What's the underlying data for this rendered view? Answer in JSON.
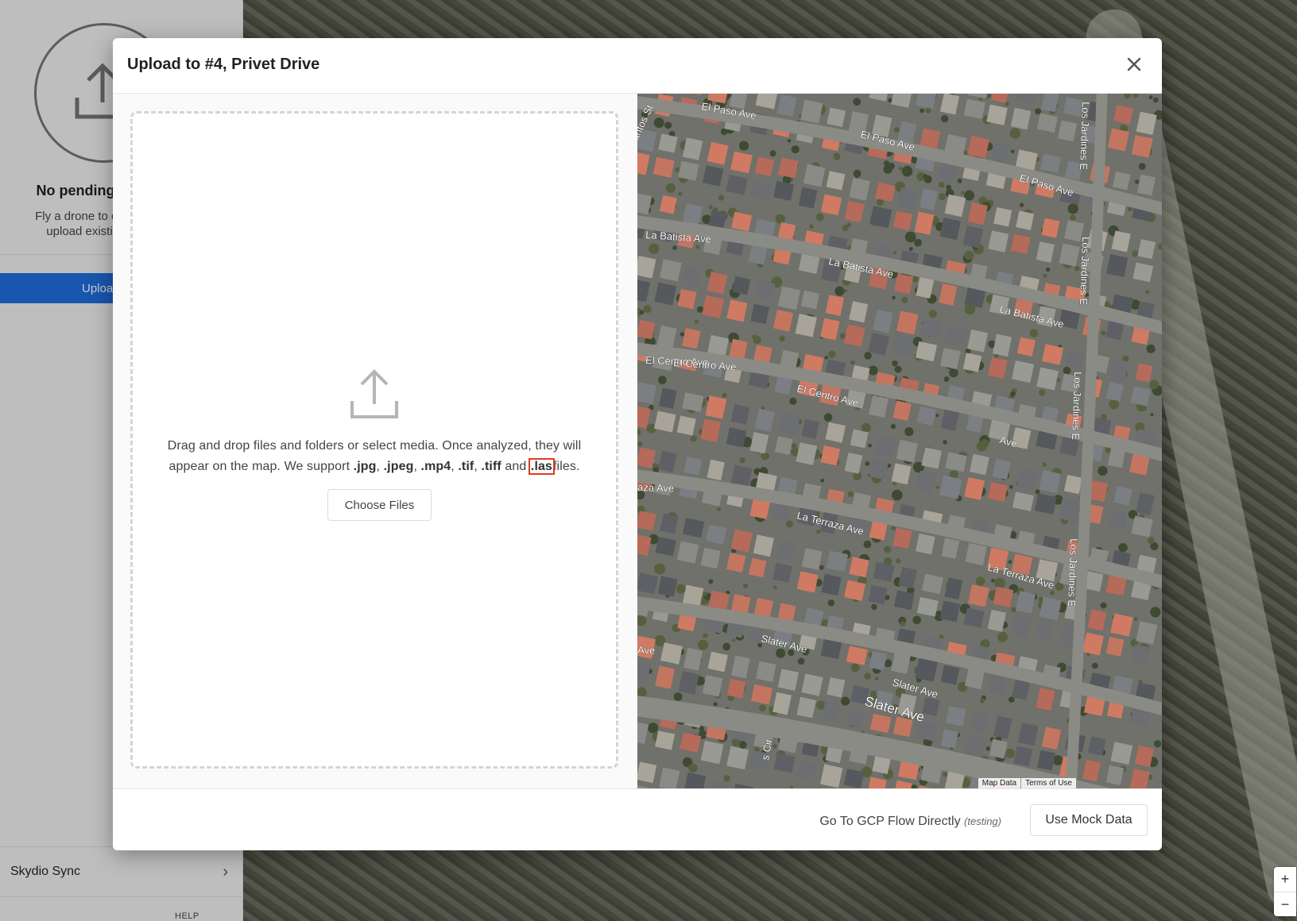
{
  "sidebar": {
    "title": "No pending",
    "desc_line1": "Fly a drone to co",
    "desc_line2": "upload existi",
    "upload_label": "Uploa",
    "sync_label": "Skydio Sync",
    "help_label": "HELP"
  },
  "modal": {
    "title": "Upload to #4, Privet Drive",
    "dropzone": {
      "text_line1": "Drag and drop files and folders or select media. Once analyzed, they will",
      "text_line2_prefix": "appear on the map. We support ",
      "formats": [
        ".jpg",
        ".jpeg",
        ".mp4",
        ".tif",
        ".tiff"
      ],
      "and_word": "and",
      "highlighted_format": ".las",
      "suffix": "files.",
      "choose_button": "Choose Files"
    },
    "map": {
      "attribution": [
        "Map Data",
        "Terms of Use"
      ],
      "street_labels": [
        "El Paso Ave",
        "El Paso Ave",
        "El Paso Ave",
        "La Batista Ave",
        "La Batista Ave",
        "La Batista Ave",
        "El Centro Ave",
        "El Centro Ave",
        "El Centro Ave",
        "Ave",
        "La Terraza Ave",
        "La Terraza Ave",
        "aza Ave",
        "Slater Ave",
        "Slater Ave",
        "Slater Ave",
        "Ave",
        "Los Jardines E",
        "Los Jardines E",
        "Los Jardines E",
        "Los Jardines E",
        "antos St",
        "s Cir"
      ]
    },
    "footer": {
      "gcp_link": "Go To GCP Flow Directly",
      "gcp_note": "(testing)",
      "mock_button": "Use Mock Data"
    }
  },
  "zoom": {
    "in": "+",
    "out": "−"
  },
  "colors": {
    "primary": "#1f6fe0",
    "highlight": "#e03b24"
  },
  "icons": [
    "upload-icon",
    "close-icon",
    "chevron-right-icon"
  ]
}
